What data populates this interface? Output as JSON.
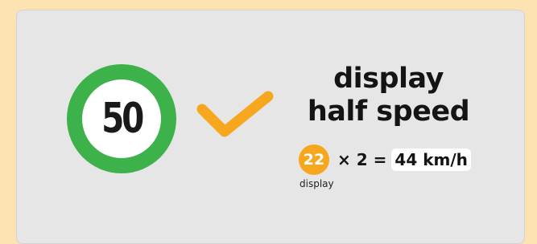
{
  "sign": {
    "speed_limit": "50"
  },
  "headline": {
    "line1": "display",
    "line2": "half speed"
  },
  "equation": {
    "displayed_value": "22",
    "multiply": "× 2",
    "equals": "=",
    "result": "44 km/h",
    "display_label": "display"
  },
  "colors": {
    "ring": "#3db24a",
    "check": "#f6a71e",
    "badge": "#f6a71e",
    "card": "#e6e6e6",
    "page": "#fde3b2"
  },
  "icons": {
    "check": "check-icon"
  }
}
